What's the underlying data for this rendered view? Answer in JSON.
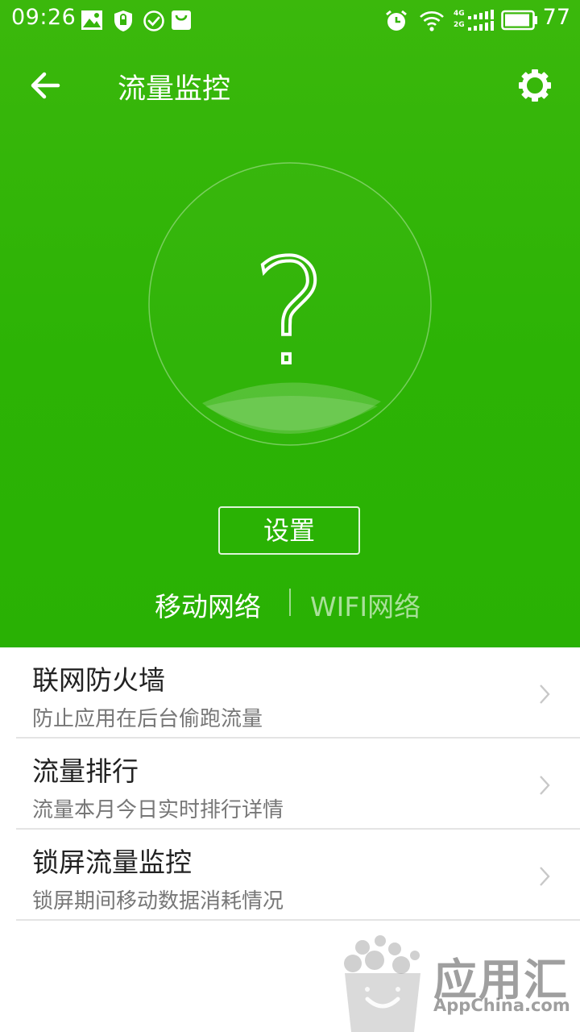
{
  "status_bar": {
    "time": "09:26",
    "battery_level": "77",
    "network_labels": [
      "4G",
      "2G"
    ]
  },
  "toolbar": {
    "title": "流量监控"
  },
  "meter": {
    "symbol": "?"
  },
  "setup_button": {
    "label": "设置"
  },
  "network_tabs": [
    {
      "label": "移动网络",
      "active": true
    },
    {
      "label": "WIFI网络",
      "active": false
    }
  ],
  "list": [
    {
      "title": "联网防火墙",
      "subtitle": "防止应用在后台偷跑流量"
    },
    {
      "title": "流量排行",
      "subtitle": "流量本月今日实时排行详情"
    },
    {
      "title": "锁屏流量监控",
      "subtitle": "锁屏期间移动数据消耗情况"
    }
  ],
  "watermark": {
    "text": "应用汇",
    "sub": "AppChina.com"
  },
  "colors": {
    "brand_green": "#2cb305",
    "list_text": "#222222",
    "list_subtext": "#777777"
  },
  "icons": {
    "status": [
      "image-icon",
      "shield-icon",
      "check-circle-icon",
      "bag-icon",
      "alarm-icon",
      "wifi-icon",
      "signal-icon",
      "battery-icon"
    ],
    "toolbar": [
      "back-arrow-icon",
      "gear-icon"
    ],
    "list": [
      "chevron-right-icon"
    ]
  }
}
